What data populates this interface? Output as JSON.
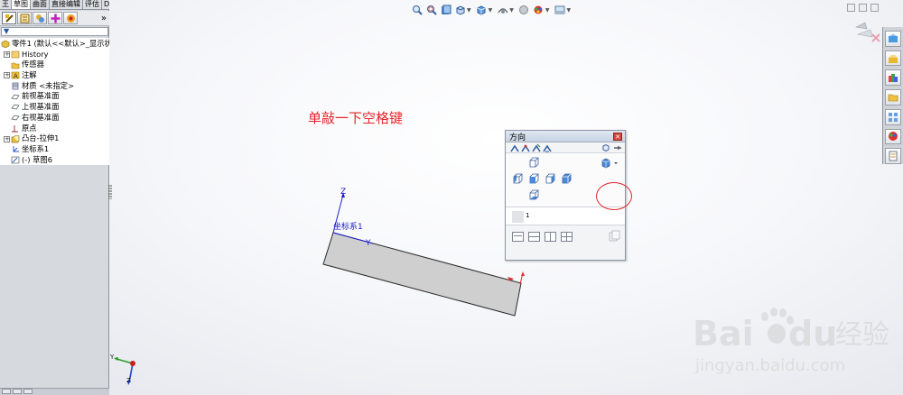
{
  "command_manager": {
    "tabs": [
      {
        "label": "王",
        "active": false
      },
      {
        "label": "草图",
        "active": true
      },
      {
        "label": "曲面",
        "active": false
      },
      {
        "label": "直接编辑",
        "active": false
      },
      {
        "label": "评估",
        "active": false
      },
      {
        "label": "DimXpert",
        "active": false
      },
      {
        "label": "办公室产品",
        "active": false
      }
    ]
  },
  "panel": {
    "more_glyph": "»",
    "tree": [
      {
        "label": "零件1 (默认<<默认>_显示状",
        "expander": "",
        "icon": "part-icon",
        "indent": 0
      },
      {
        "label": "History",
        "expander": "+",
        "icon": "history-icon",
        "indent": 1
      },
      {
        "label": "传感器",
        "expander": "",
        "icon": "sensor-icon",
        "indent": 1
      },
      {
        "label": "注解",
        "expander": "+",
        "icon": "annotation-icon",
        "indent": 1
      },
      {
        "label": "材质 <未指定>",
        "expander": "",
        "icon": "material-icon",
        "indent": 1
      },
      {
        "label": "前视基准面",
        "expander": "",
        "icon": "plane-icon",
        "indent": 1
      },
      {
        "label": "上视基准面",
        "expander": "",
        "icon": "plane-icon",
        "indent": 1
      },
      {
        "label": "右视基准面",
        "expander": "",
        "icon": "plane-icon",
        "indent": 1
      },
      {
        "label": "原点",
        "expander": "",
        "icon": "origin-icon",
        "indent": 1
      },
      {
        "label": "凸台-拉伸1",
        "expander": "+",
        "icon": "extrude-icon",
        "indent": 1
      },
      {
        "label": "坐标系1",
        "expander": "",
        "icon": "coordinate-system-icon",
        "indent": 1
      },
      {
        "label": "(-) 草图6",
        "expander": "",
        "icon": "sketch-icon",
        "indent": 1
      }
    ]
  },
  "annotation": {
    "text": "单敲一下空格键",
    "color": "#e8252a"
  },
  "orientation_dialog": {
    "title": "方向",
    "field_value": "1"
  },
  "model": {
    "axis_z_label": "Z",
    "axis_y_label": "Y",
    "coordinate_system_label": "坐标系1",
    "axis_color": "#2020d0"
  },
  "triad": {
    "y_label": "Y",
    "z_label": "Z"
  },
  "watermark": {
    "brand": "Bai",
    "brand_tail": "du",
    "cn": "经验",
    "url": "jingyan.baidu.com"
  }
}
